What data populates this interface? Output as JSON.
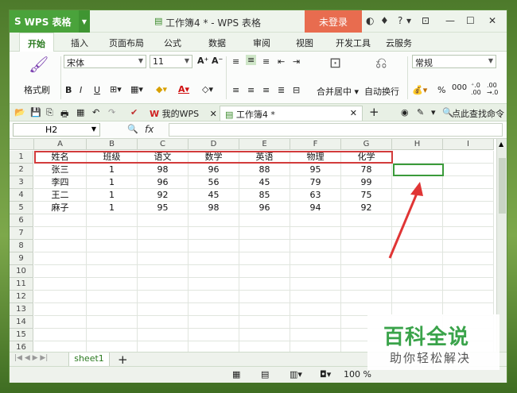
{
  "app": {
    "name": "WPS 表格",
    "window_title": "工作簿4 * - WPS 表格",
    "login_label": "未登录"
  },
  "menu": {
    "tabs": [
      "开始",
      "插入",
      "页面布局",
      "公式",
      "数据",
      "审阅",
      "视图",
      "开发工具",
      "云服务"
    ]
  },
  "ribbon": {
    "format_painter": "格式刷",
    "font_name": "宋体",
    "font_size": "11",
    "merge_center": "合并居中",
    "wrap_text": "自动换行",
    "number_format": "常规",
    "percent": "%",
    "comma": "000"
  },
  "doc_tabs": {
    "mywps": "我的WPS",
    "workbook": "工作簿4 *",
    "search": "点此查找命令"
  },
  "formula_bar": {
    "name_box": "H2",
    "fx": "fx",
    "value": ""
  },
  "grid": {
    "columns": [
      "A",
      "B",
      "C",
      "D",
      "E",
      "F",
      "G",
      "H",
      "I"
    ],
    "rows": [
      "1",
      "2",
      "3",
      "4",
      "5",
      "6",
      "7",
      "8",
      "9",
      "10",
      "11",
      "12",
      "13",
      "14",
      "15",
      "16"
    ],
    "data": [
      [
        "姓名",
        "班级",
        "语文",
        "数学",
        "英语",
        "物理",
        "化学"
      ],
      [
        "张三",
        "1",
        "98",
        "96",
        "88",
        "95",
        "78"
      ],
      [
        "李四",
        "1",
        "96",
        "56",
        "45",
        "79",
        "99"
      ],
      [
        "王二",
        "1",
        "92",
        "45",
        "85",
        "63",
        "75"
      ],
      [
        "麻子",
        "1",
        "95",
        "98",
        "96",
        "94",
        "92"
      ]
    ]
  },
  "sheet": {
    "tab": "sheet1",
    "add": "+"
  },
  "status": {
    "zoom": "100 %"
  },
  "watermark": {
    "title": "百科全说",
    "subtitle": "助你轻松解决"
  }
}
